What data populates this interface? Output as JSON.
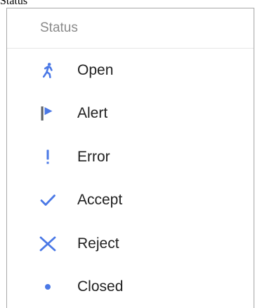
{
  "caption": "Status",
  "menu": {
    "header": "Status",
    "accent_color": "#4a78e6",
    "items": [
      {
        "label": "Open",
        "icon": "walking-person-icon"
      },
      {
        "label": "Alert",
        "icon": "flag-icon"
      },
      {
        "label": "Error",
        "icon": "exclamation-icon"
      },
      {
        "label": "Accept",
        "icon": "checkmark-icon"
      },
      {
        "label": "Reject",
        "icon": "x-icon"
      },
      {
        "label": "Closed",
        "icon": "dot-icon"
      }
    ]
  }
}
